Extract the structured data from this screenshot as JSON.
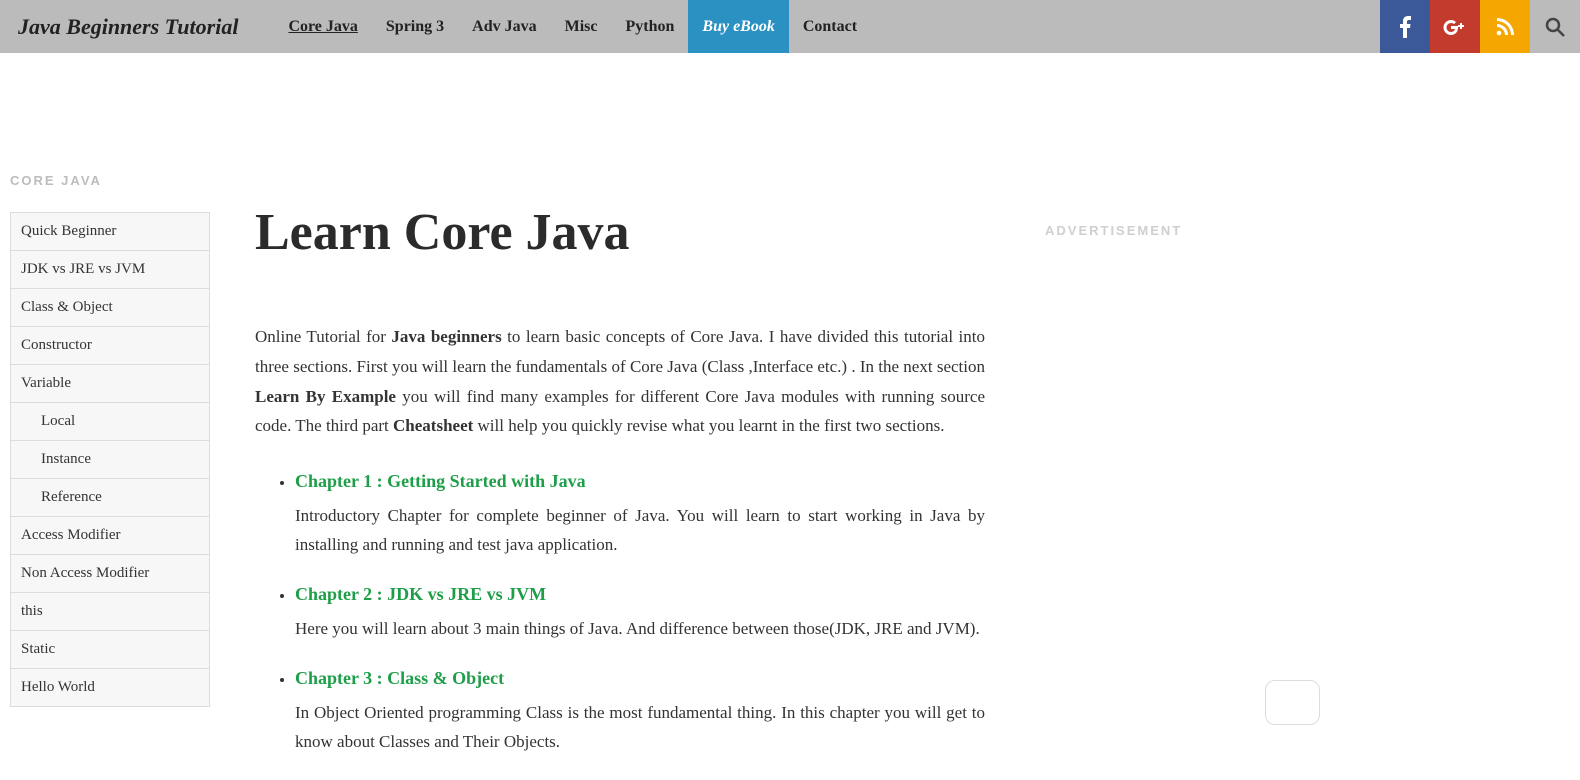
{
  "site_title": "Java Beginners Tutorial",
  "nav": [
    {
      "label": "Core Java",
      "active": true
    },
    {
      "label": "Spring 3"
    },
    {
      "label": "Adv Java"
    },
    {
      "label": "Misc"
    },
    {
      "label": "Python"
    },
    {
      "label": "Buy eBook",
      "buy": true
    },
    {
      "label": "Contact"
    }
  ],
  "sidebar_title": "CORE JAVA",
  "sidebar_items": [
    {
      "label": "Quick Beginner"
    },
    {
      "label": "JDK vs JRE vs JVM"
    },
    {
      "label": "Class & Object"
    },
    {
      "label": "Constructor"
    },
    {
      "label": "Variable"
    },
    {
      "label": "Local",
      "sub": true
    },
    {
      "label": "Instance",
      "sub": true
    },
    {
      "label": "Reference",
      "sub": true
    },
    {
      "label": "Access Modifier"
    },
    {
      "label": "Non Access Modifier"
    },
    {
      "label": "this"
    },
    {
      "label": "Static"
    },
    {
      "label": "Hello World"
    }
  ],
  "page_title": "Learn Core Java",
  "intro": {
    "t1": "Online Tutorial for ",
    "b1": "Java beginners",
    "t2": " to learn basic concepts of Core Java. I have divided this tutorial into three sections. First you will learn the fundamentals of Core Java (Class ,Interface etc.) . In the next section ",
    "b2": "Learn By Example",
    "t3": " you will find many examples for different Core Java modules with running source code. The third part ",
    "b3": "Cheatsheet",
    "t4": " will help you quickly revise what you learnt in the first two sections."
  },
  "chapters": [
    {
      "title": "Chapter 1 : Getting Started with Java",
      "desc": "Introductory Chapter for complete beginner of Java. You will learn to start working in Java by installing and running and test java application."
    },
    {
      "title": "Chapter 2 : JDK vs JRE vs JVM",
      "desc": "Here you will learn about 3 main things of Java. And difference between those(JDK, JRE and JVM)."
    },
    {
      "title": "Chapter 3 : Class & Object",
      "desc": "In Object Oriented programming Class is the most fundamental thing. In this chapter you will get to know about Classes and Their Objects."
    }
  ],
  "ad_label": "ADVERTISEMENT"
}
